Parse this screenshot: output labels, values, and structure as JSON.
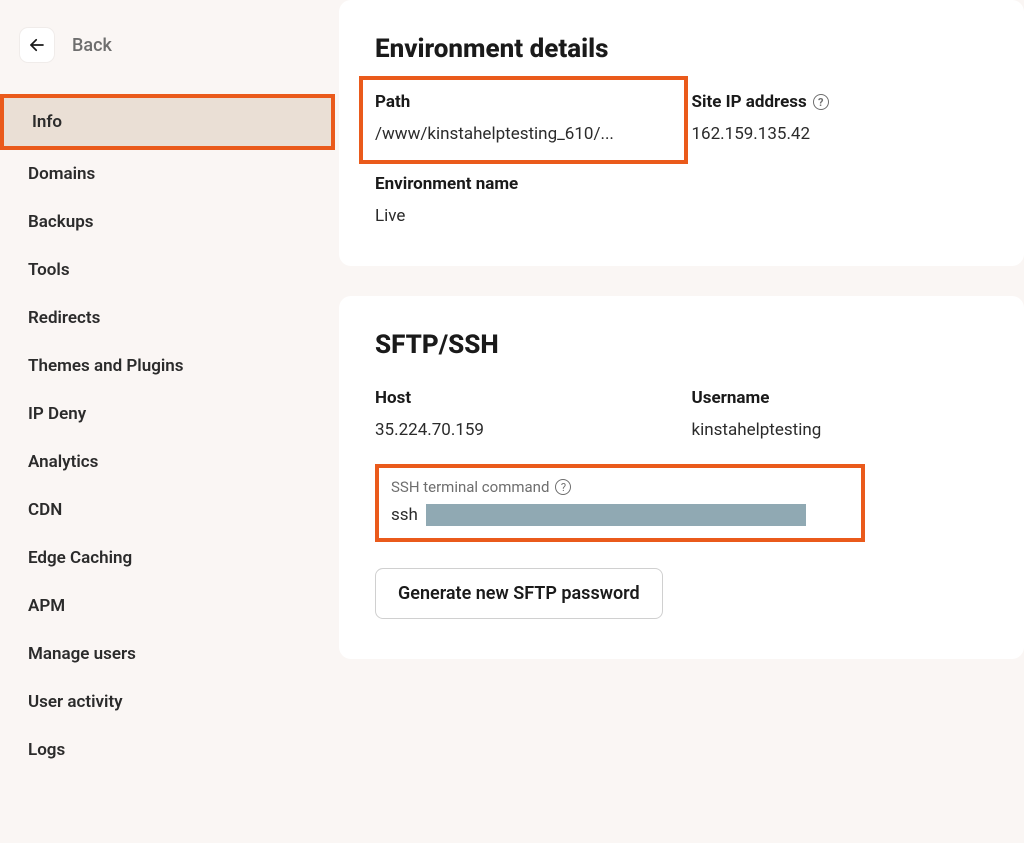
{
  "back": {
    "label": "Back"
  },
  "sidebar": {
    "items": [
      {
        "label": "Info",
        "active": true
      },
      {
        "label": "Domains"
      },
      {
        "label": "Backups"
      },
      {
        "label": "Tools"
      },
      {
        "label": "Redirects"
      },
      {
        "label": "Themes and Plugins"
      },
      {
        "label": "IP Deny"
      },
      {
        "label": "Analytics"
      },
      {
        "label": "CDN"
      },
      {
        "label": "Edge Caching"
      },
      {
        "label": "APM"
      },
      {
        "label": "Manage users"
      },
      {
        "label": "User activity"
      },
      {
        "label": "Logs"
      }
    ]
  },
  "env": {
    "title": "Environment details",
    "path_label": "Path",
    "path_value": "/www/kinstahelptesting_610/...",
    "ip_label": "Site IP address",
    "ip_value": "162.159.135.42",
    "envname_label": "Environment name",
    "envname_value": "Live"
  },
  "sftp": {
    "title": "SFTP/SSH",
    "host_label": "Host",
    "host_value": "35.224.70.159",
    "user_label": "Username",
    "user_value": "kinstahelptesting",
    "ssh_label": "SSH terminal command",
    "ssh_prefix": "ssh",
    "button": "Generate new SFTP password"
  },
  "glyph": {
    "help": "?"
  }
}
